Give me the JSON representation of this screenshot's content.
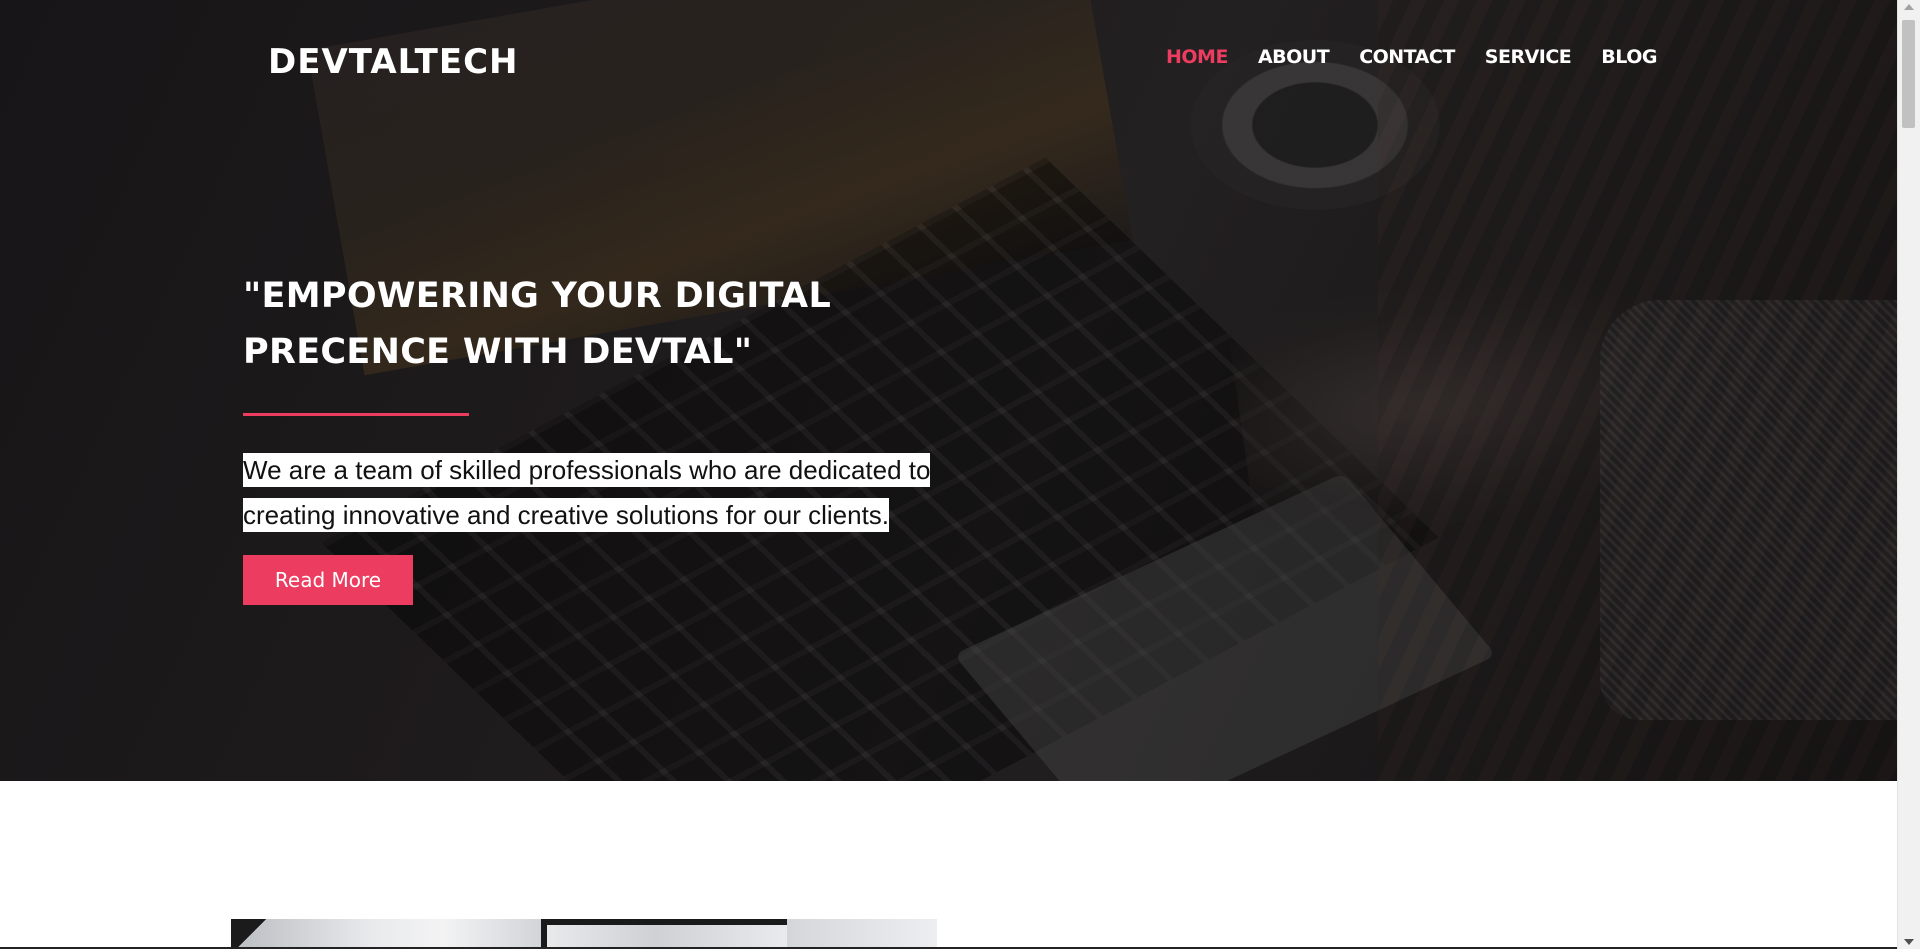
{
  "header": {
    "logo": "DEVTALTECH",
    "nav": [
      {
        "label": "HOME",
        "active": true
      },
      {
        "label": "ABOUT",
        "active": false
      },
      {
        "label": "CONTACT",
        "active": false
      },
      {
        "label": "SERVICE",
        "active": false
      },
      {
        "label": "BLOG",
        "active": false
      }
    ]
  },
  "hero": {
    "title": "\"EMPOWERING YOUR DIGITAL PRECENCE WITH DEVTAL\"",
    "description": "We are a team of skilled professionals who are dedicated to creating innovative and creative solutions for our clients. ",
    "button_label": "Read More"
  },
  "colors": {
    "accent": "#ec3c5f",
    "hero_overlay": "#1c1a1b",
    "text_light": "#ffffff"
  }
}
